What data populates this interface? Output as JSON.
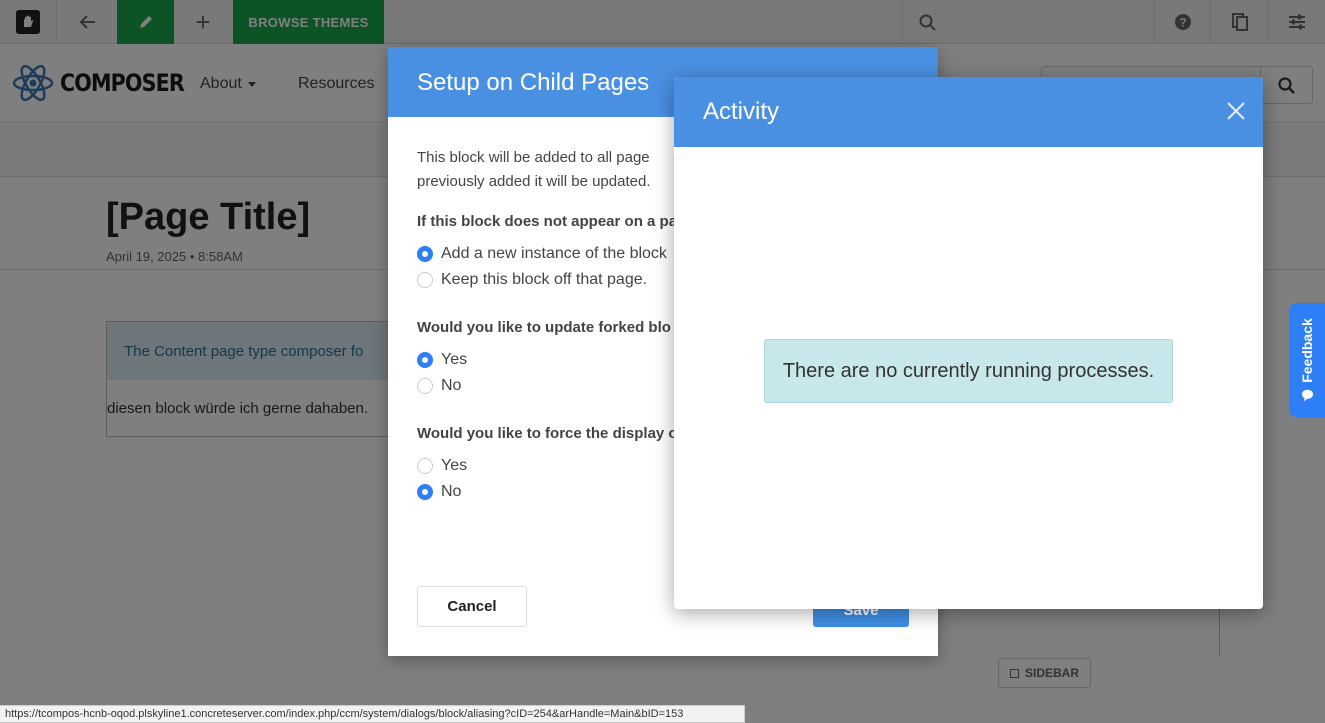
{
  "toolbar": {
    "browse_themes": "BROWSE THEMES",
    "accent": "#19a84a"
  },
  "site": {
    "brand": "COMPOSER",
    "nav": [
      {
        "label": "About",
        "has_dropdown": true
      },
      {
        "label": "Resources",
        "has_dropdown": false
      }
    ],
    "search_placeholder": ""
  },
  "page": {
    "title": "[Page Title]",
    "date": "April 19, 2025 • 8:58AM",
    "note": "The Content page type composer fo",
    "block_text": "diesen block würde ich gerne dahaben.",
    "sidebar_label": "SIDEBAR"
  },
  "setup_dialog": {
    "title": "Setup on Child Pages",
    "intro_line1": "This block will be added to all page",
    "intro_line2": "previously added it will be updated.",
    "q1": "If this block does not appear on a pa",
    "q1_options": [
      {
        "label": "Add a new instance of the block",
        "checked": true
      },
      {
        "label": "Keep this block off that page.",
        "checked": false
      }
    ],
    "q2": "Would you like to update forked blo",
    "q2_options": [
      {
        "label": "Yes",
        "checked": true
      },
      {
        "label": "No",
        "checked": false
      }
    ],
    "q3": "Would you like to force the display o",
    "q3_options": [
      {
        "label": "Yes",
        "checked": false
      },
      {
        "label": "No",
        "checked": true
      }
    ],
    "cancel_label": "Cancel",
    "save_label": "Save",
    "header_color": "#4a90e2"
  },
  "activity_dialog": {
    "title": "Activity",
    "message": "There are no currently running processes."
  },
  "feedback": {
    "label": "Feedback",
    "color": "#2d7ef7"
  },
  "status_url": "https://tcompos-hcnb-oqod.plskyline1.concreteserver.com/index.php/ccm/system/dialogs/block/aliasing?cID=254&arHandle=Main&bID=153"
}
